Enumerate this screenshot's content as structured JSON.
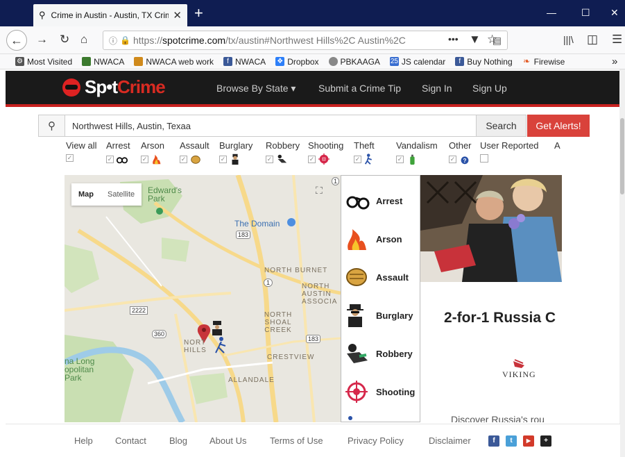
{
  "browser": {
    "tab_title": "Crime in Austin - Austin, TX Crime",
    "url_prefix": "https://",
    "url_domain": "spotcrime.com",
    "url_path": "/tx/austin#Northwest Hills%2C Austin%2C",
    "bookmarks": [
      {
        "label": "Most Visited",
        "icon": "gear-icon",
        "color": "#555555"
      },
      {
        "label": "NWACA",
        "icon": "mower-icon",
        "color": "#3c7a2e"
      },
      {
        "label": "NWACA web work",
        "icon": "people-icon",
        "color": "#d08a1c"
      },
      {
        "label": "NWACA",
        "icon": "facebook-icon",
        "color": "#3b5998"
      },
      {
        "label": "Dropbox",
        "icon": "dropbox-icon",
        "color": "#2d7ff9"
      },
      {
        "label": "PBKAAGA",
        "icon": "globe-icon",
        "color": "#888888"
      },
      {
        "label": "JS calendar",
        "icon": "calendar-icon",
        "color": "#3a6fd1"
      },
      {
        "label": "Buy Nothing",
        "icon": "facebook-icon",
        "color": "#3b5998"
      },
      {
        "label": "Firewise",
        "icon": "flame-icon",
        "color": "#e25822"
      }
    ]
  },
  "site": {
    "logo_spot": "Sp•t",
    "logo_crime": "Crime",
    "nav": {
      "browse": "Browse By State ▾",
      "submit": "Submit a Crime Tip",
      "signin": "Sign In",
      "signup": "Sign Up"
    },
    "search": {
      "value": "Northwest Hills, Austin, Texaa",
      "search_label": "Search",
      "alerts_label": "Get Alerts!"
    },
    "filters": {
      "view_all": "View all",
      "arrest": "Arrest",
      "arson": "Arson",
      "assault": "Assault",
      "burglary": "Burglary",
      "robbery": "Robbery",
      "shooting": "Shooting",
      "theft": "Theft",
      "vandalism": "Vandalism",
      "other": "Other",
      "user_reported": "User Reported",
      "more": "A"
    }
  },
  "map": {
    "map_label": "Map",
    "satellite_label": "Satellite",
    "places": {
      "edwards_park": "Edward's Park",
      "the_domain": "The Domain",
      "north_burnet": "NORTH BURNET",
      "north_austin": "NORTH AUSTIN ASSOCIA",
      "north_shoal": "NORTH SHOAL CREEK",
      "northwest_hills": "NORT HILLS",
      "crestview": "CRESTVIEW",
      "allandale": "ALLANDALE",
      "long_park": "na Long opolitan Park"
    },
    "shields": {
      "r183a": "183",
      "r1a": "1",
      "r1b": "1",
      "r2222": "2222",
      "r360": "360",
      "r183b": "183"
    }
  },
  "legend": [
    {
      "label": "Arrest",
      "icon": "handcuffs-icon"
    },
    {
      "label": "Arson",
      "icon": "fire-icon"
    },
    {
      "label": "Assault",
      "icon": "fist-icon"
    },
    {
      "label": "Burglary",
      "icon": "burglar-icon"
    },
    {
      "label": "Robbery",
      "icon": "robber-icon"
    },
    {
      "label": "Shooting",
      "icon": "crosshair-icon"
    }
  ],
  "ad": {
    "headline": "2-for-1 Russia C",
    "brand": "VIKING",
    "sub": "Discover Russia's rou"
  },
  "footer": {
    "links": [
      "Help",
      "Contact",
      "Blog",
      "About Us",
      "Terms of Use",
      "Privacy Policy",
      "Disclaimer"
    ],
    "social": [
      {
        "icon": "facebook-icon",
        "glyph": "f",
        "color": "#3b5998"
      },
      {
        "icon": "twitter-icon",
        "glyph": "t",
        "color": "#4aa0d8"
      },
      {
        "icon": "youtube-icon",
        "glyph": "▶",
        "color": "#d23a2a"
      },
      {
        "icon": "google-plus-icon",
        "glyph": "+",
        "color": "#222222"
      }
    ]
  }
}
